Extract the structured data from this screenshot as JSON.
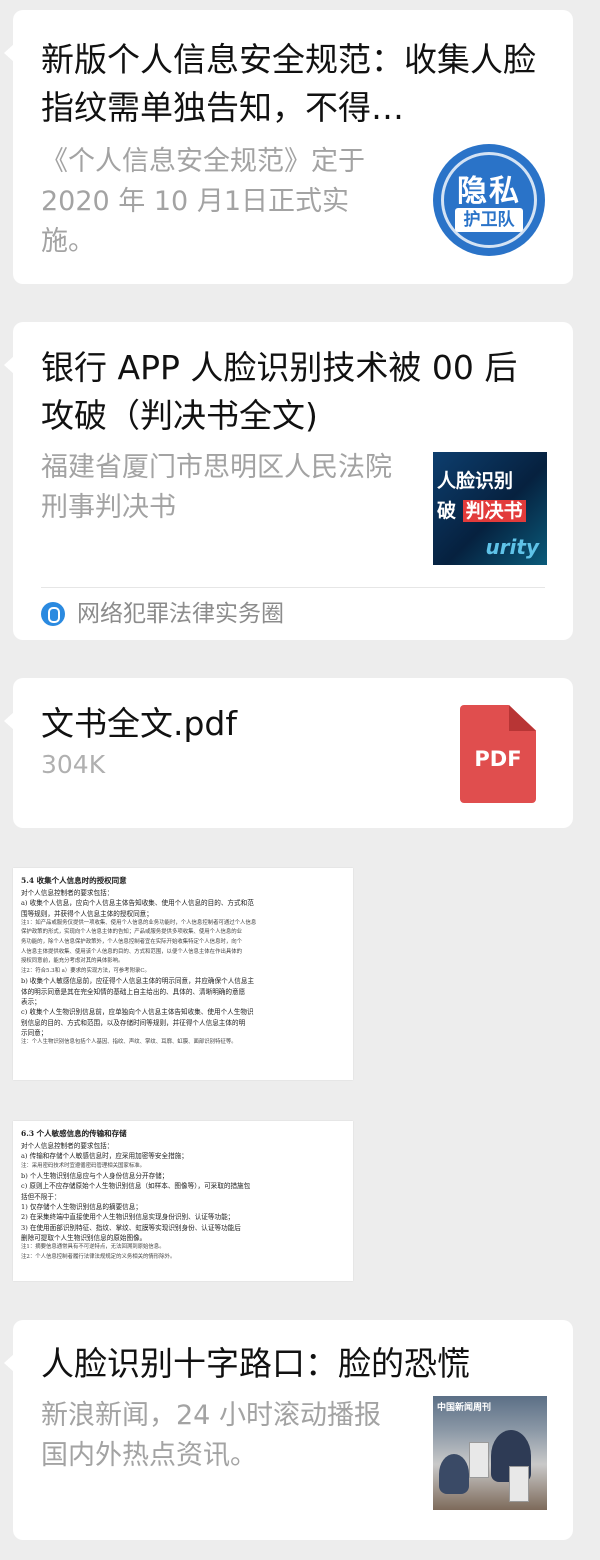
{
  "cards": [
    {
      "title": "新版个人信息安全规范：收集人脸指纹需单独告知，不得…",
      "desc": "《个人信息安全规范》定于 2020 年 10 月1日正式实施。",
      "thumb_text": [
        "隐私",
        "护卫队"
      ]
    },
    {
      "title": "银行 APP 人脸识别技术被 00 后攻破（判决书全文)",
      "desc": "福建省厦门市思明区人民法院刑事判决书",
      "thumb_text": [
        "人脸识别",
        "破",
        "判决书",
        "urity"
      ],
      "source": "网络犯罪法律实务圈"
    },
    {
      "title": "人脸识别十字路口：脸的恐慌",
      "desc": "新浪新闻，24 小时滚动播报国内外热点资讯。",
      "thumb_caption": "中国新闻周刊"
    }
  ],
  "file": {
    "name": "文书全文.pdf",
    "size": "304K",
    "icon_label": "PDF",
    "icon_color": "#e04e4e"
  },
  "doc1": {
    "heading": "5.4  收集个人信息时的授权同意",
    "lines": [
      "对个人信息控制者的要求包括：",
      "a)  收集个人信息，应向个人信息主体告知收集、使用个人信息的目的、方式和范",
      "     围等规则，并获得个人信息主体的授权同意；",
      "注1：如产品或服务仅提供一项收集、使用个人信息的业务功能时，个人信息控制者可通过个人信息",
      "保护政策的形式，实现向个人信息主体的告知；产品或服务提供多项收集、使用个人信息的业",
      "务功能的，除个人信息保护政策外，个人信息控制者宜在实际开始收集特定个人信息时，向个",
      "人信息主体提供收集、使用该个人信息的目的、方式和范围，以便个人信息主体在作出具体的",
      "授权同意前，能充分考虑对其的具体影响。",
      "注2：符合5.3和 a）要求的实现方法，可参考附录C。",
      "b)  收集个人敏感信息前，应征得个人信息主体的明示同意，并应确保个人信息主",
      "     体的明示同意是其在完全知情的基础上自主给出的、具体的、清晰明确的意愿",
      "     表示；",
      "c)  收集个人生物识别信息前，应单独向个人信息主体告知收集、使用个人生物识",
      "     别信息的目的、方式和范围，以及存储时间等规则，并征得个人信息主体的明",
      "     示同意；",
      "注：个人生物识别信息包括个人基因、指纹、声纹、掌纹、耳廓、虹膜、面部识别特征等。"
    ]
  },
  "doc2": {
    "heading": "6.3  个人敏感信息的传输和存储",
    "lines": [
      "对个人信息控制者的要求包括：",
      "a)  传输和存储个人敏感信息时，应采用加密等安全措施；",
      "注：采用密码技术时宜遵循密码管理相关国家标准。",
      "b)  个人生物识别信息应与个人身份信息分开存储；",
      "c)  原则上不应存储原始个人生物识别信息（如样本、图像等），可采取的措施包",
      "     括但不限于：",
      "     1)  仅存储个人生物识别信息的摘要信息；",
      "     2)  在采集终端中直接使用个人生物识别信息实现身份识别、认证等功能；",
      "     3)  在使用面部识别特征、指纹、掌纹、虹膜等实现识别身份、认证等功能后",
      "          删除可提取个人生物识别信息的原始图像。",
      "注1：摘要信息通常具有不可逆特点，无法回溯到原始信息。",
      "注2：个人信息控制者履行法律法规规定的义务相关的情形除外。"
    ]
  }
}
